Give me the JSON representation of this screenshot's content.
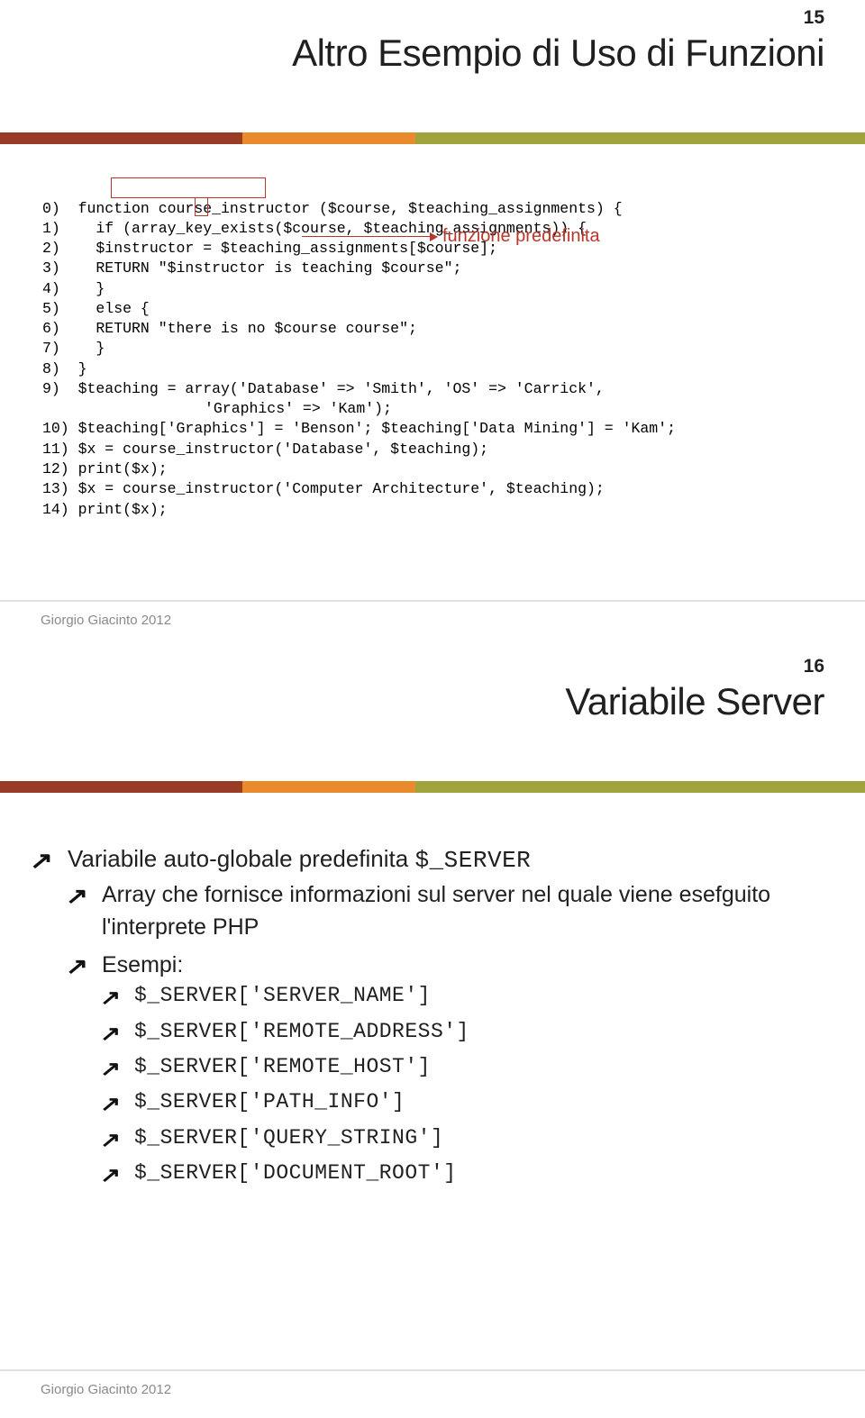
{
  "slide1": {
    "page": "15",
    "title": "Altro Esempio di Uso di Funzioni",
    "annotation": "funzione predefinita",
    "code": {
      "l0": "0)  function course_instructor ($course, $teaching_assignments) {",
      "l1": "1)    if (array_key_exists($course, $teaching_assignments)) {",
      "l2": "2)    $instructor = $teaching_assignments[$course];",
      "l3": "3)    RETURN \"$instructor is teaching $course\";",
      "l4": "4)    }",
      "l5": "5)    else {",
      "l6": "6)    RETURN \"there is no $course course\";",
      "l7": "7)    }",
      "l8": "8)  }",
      "l9": "9)  $teaching = array('Database' => 'Smith', 'OS' => 'Carrick',",
      "l9b": "'Graphics' => 'Kam');",
      "l10": "10) $teaching['Graphics'] = 'Benson'; $teaching['Data Mining'] = 'Kam';",
      "l11": "11) $x = course_instructor('Database', $teaching);",
      "l12": "12) print($x);",
      "l13": "13) $x = course_instructor('Computer Architecture', $teaching);",
      "l14": "14) print($x);"
    },
    "footer": "Giorgio Giacinto 2012"
  },
  "slide2": {
    "page": "16",
    "title": "Variabile Server",
    "bullet1_pre": "Variabile auto-globale predefinita ",
    "bullet1_code": "$_SERVER",
    "sub1": "Array che fornisce informazioni sul server nel quale viene esefguito l'interprete PHP",
    "sub2": "Esempi:",
    "examples": {
      "e1": "$_SERVER['SERVER_NAME']",
      "e2": "$_SERVER['REMOTE_ADDRESS']",
      "e3": "$_SERVER['REMOTE_HOST']",
      "e4": "$_SERVER['PATH_INFO']",
      "e5": "$_SERVER['QUERY_STRING']",
      "e6": "$_SERVER['DOCUMENT_ROOT']"
    },
    "footer": "Giorgio Giacinto 2012"
  }
}
